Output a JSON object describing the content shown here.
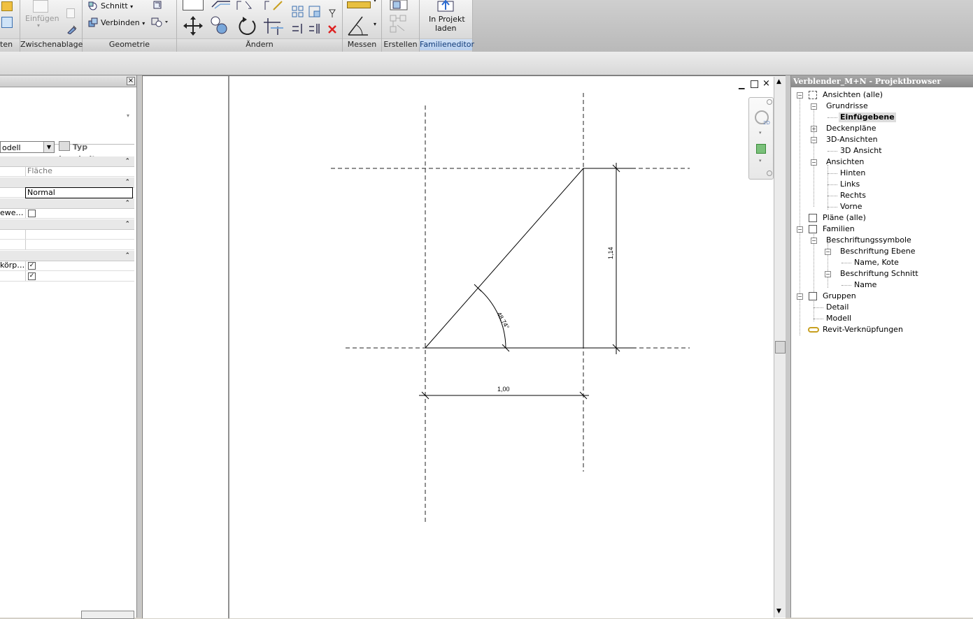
{
  "ribbon": {
    "panels": [
      {
        "label": "ten"
      },
      {
        "label": "Zwischenablage"
      },
      {
        "label": "Geometrie"
      },
      {
        "label": "Ändern"
      },
      {
        "label": "Messen"
      },
      {
        "label": "Erstellen"
      },
      {
        "label": "Familieneditor"
      }
    ],
    "einfuegen": "Einfügen",
    "schnitt": "Schnitt",
    "verbinden": "Verbinden",
    "in_projekt_line1": "In Projekt",
    "in_projekt_line2": "laden"
  },
  "properties": {
    "type_value": "odell",
    "type_edit": "Typ bearbeiten",
    "rows": {
      "flaeche": "Fläche",
      "normal": "Normal",
      "sichtbar_label": "ewe…",
      "koerper_label": "körp…"
    },
    "checks": {
      "sichtbar": false,
      "koerper": true,
      "row2": true
    }
  },
  "drawing": {
    "dim_horizontal": "1,00",
    "dim_vertical": "1,14",
    "dim_angle": "48,74°"
  },
  "browser": {
    "title": "Verblender_M+N - Projektbrowser",
    "nodes": {
      "ansichten_alle": "Ansichten (alle)",
      "grundrisse": "Grundrisse",
      "einfuegebene": "Einfügebene",
      "deckenplaene": "Deckenpläne",
      "ansichten_3d": "3D-Ansichten",
      "ansicht_3d": "3D Ansicht",
      "ansichten": "Ansichten",
      "hinten": "Hinten",
      "links": "Links",
      "rechts": "Rechts",
      "vorne": "Vorne",
      "plaene": "Pläne (alle)",
      "familien": "Familien",
      "beschriftungssymbole": "Beschriftungssymbole",
      "beschriftung_ebene": "Beschriftung Ebene",
      "name_kote": "Name, Kote",
      "beschriftung_schnitt": "Beschriftung Schnitt",
      "name": "Name",
      "gruppen": "Gruppen",
      "detail": "Detail",
      "modell": "Modell",
      "revit_verknuepfungen": "Revit-Verknüpfungen"
    }
  }
}
